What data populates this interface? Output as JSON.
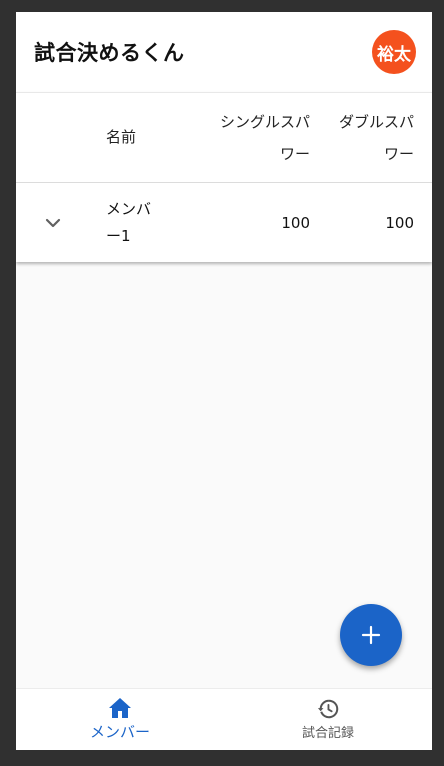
{
  "app_bar": {
    "title": "試合決めるくん",
    "avatar_text": "裕太"
  },
  "table": {
    "columns": [
      "名前",
      "シングルスパワー",
      "ダブルスパワー"
    ],
    "header_single_line1": "シングルスパ",
    "header_single_line2": "ワー",
    "header_double_line1": "ダブルスパ",
    "header_double_line2": "ワー",
    "rows": [
      {
        "name_line1": "メンバ",
        "name_line2": "ー1",
        "single_power": "100",
        "double_power": "100"
      }
    ]
  },
  "bottom_nav": {
    "items": [
      {
        "label": "メンバー",
        "icon": "home-icon",
        "active": true
      },
      {
        "label": "試合記録",
        "icon": "history-icon",
        "active": false
      }
    ]
  },
  "colors": {
    "primary": "#1b64c8",
    "avatar": "#f4511e"
  }
}
